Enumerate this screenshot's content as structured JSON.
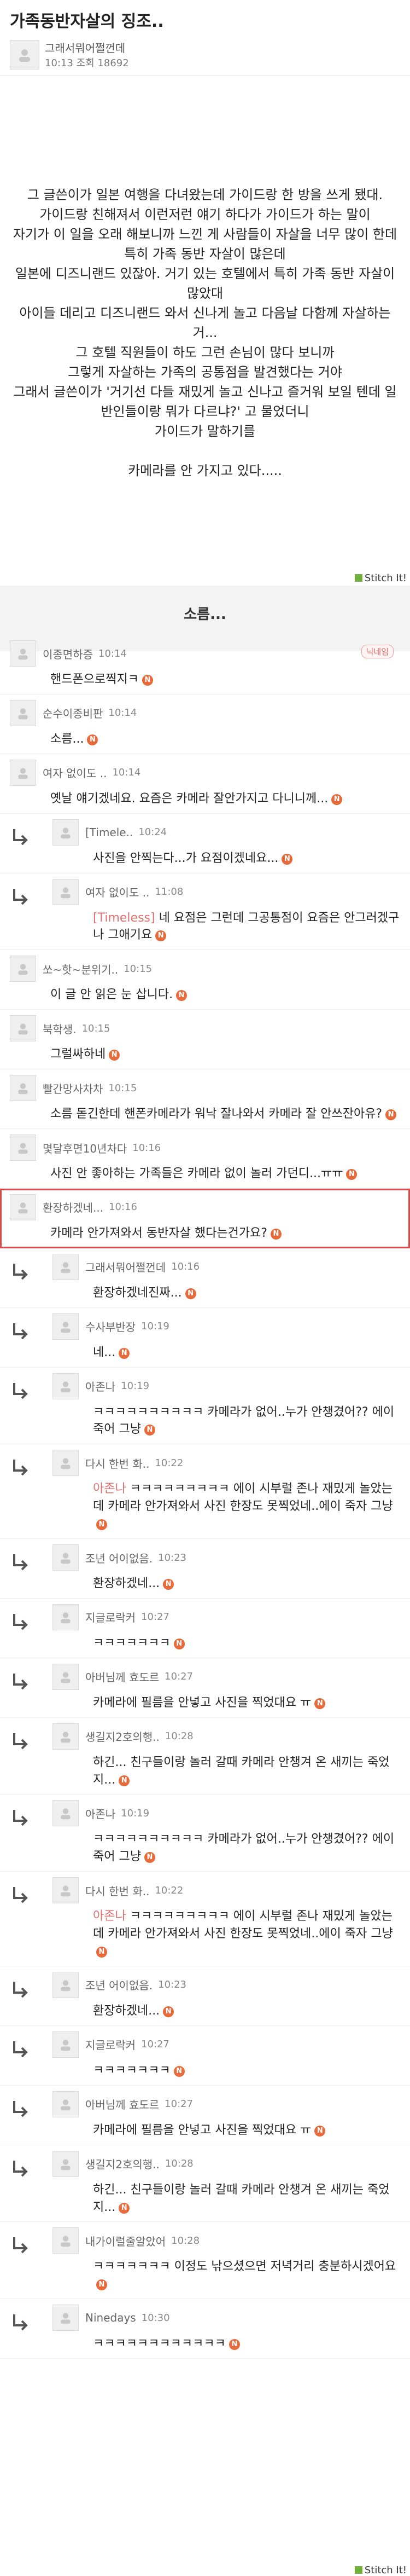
{
  "post": {
    "title": "가족동반자살의 징조..",
    "author": "그래서뭐어쩔껀데",
    "meta": "10:13  조회 18692",
    "lines": [
      "그 글쓴이가 일본 여행을 다녀왔는데 가이드랑 한 방을 쓰게 됐대.",
      "가이드랑 친해져서 이런저런 얘기 하다가 가이드가 하는 말이",
      "자기가 이 일을 오래 해보니까 느낀 게 사람들이 자살을 너무 많이 한데",
      "특히 가족 동반 자살이 많은데",
      "일본에 디즈니랜드 있잖아. 거기 있는 호텔에서 특히 가족 동반 자살이 많았대",
      "아이들 데리고 디즈니랜드 와서 신나게 놀고 다음날 다함께 자살하는 거...",
      "그 호텔 직원들이 하도 그런 손님이 많다 보니까",
      "그렇게 자살하는 가족의 공통점을 발견했다는 거야",
      "그래서 글쓴이가 '거기선 다들 재밌게 놀고 신나고 즐거워 보일 텐데 일반인들이랑 뭐가 다르냐?' 고 물었더니",
      "가이드가 말하기를",
      "",
      "카메라를 안 가지고 있다....."
    ],
    "separator": "소름...",
    "stitch": "Stitch It!"
  },
  "comments": [
    {
      "nick": "이종면하증",
      "time": "10:14",
      "text": "핸드폰으로찍지ㅋ",
      "badge": "닉네임"
    },
    {
      "nick": "순수이종비판",
      "time": "10:14",
      "text": "소름..."
    },
    {
      "nick": "여자 없이도 ..",
      "time": "10:14",
      "text": "옛날 얘기겠네요.  요즘은 카메라 잘안가지고 다니니께..."
    },
    {
      "nick": "[Timele..",
      "time": "10:24",
      "text": "사진을 안찍는다...가 요점이겠네요...",
      "reply": true
    },
    {
      "nick": "여자 없이도 ..",
      "time": "11:08",
      "text": "[Timeless] 네 요점은 그런데 그공통점이 요즘은 안그러겠구나 그애기요",
      "mention": "[Timeless]",
      "reply": true
    },
    {
      "nick": "쏘~핫~분위기..",
      "time": "10:15",
      "text": "이 글 안 읽은 눈 삽니다."
    },
    {
      "nick": "북학생.",
      "time": "10:15",
      "text": "그럴싸하네"
    },
    {
      "nick": "빨간망사차차",
      "time": "10:15",
      "text": "소름 돋긴한데 핸폰카메라가 워낙 잘나와서 카메라 잘 안쓰잔아유?"
    },
    {
      "nick": "몇달후면10년차다",
      "time": "10:16",
      "text": "사진 안 좋아하는 가족들은 카메라 없이 놀러 가던디...ㅠㅠ"
    },
    {
      "nick": "환장하겠네...",
      "time": "10:16",
      "text": "카메라 안가져와서 동반자살 했다는건가요?",
      "highlight": true
    },
    {
      "nick": "그래서뭐어쩔껀데",
      "time": "10:16",
      "text": "환장하겠네진짜...",
      "reply": true
    },
    {
      "nick": "수사부반장",
      "time": "10:19",
      "text": "네...",
      "reply": true
    },
    {
      "nick": "아존나",
      "time": "10:19",
      "text": "ㅋㅋㅋㅋㅋㅋㅋㅋㅋㅋ 카메라가 없어..누가 안챙겼어?? 에이 죽어 그냥",
      "reply": true
    },
    {
      "nick": "다시 한번 화..",
      "time": "10:22",
      "text": "아존나 ㅋㅋㅋㅋㅋㅋㅋㅋㅋ 에이 시부럴 존나 재밌게 놀았는데 카메라 안가져와서 사진 한장도 못찍었네..에이 죽자 그냥",
      "mention": "아존나",
      "reply": true
    },
    {
      "nick": "조년 어이없음.",
      "time": "10:23",
      "text": "환장하겠네...",
      "reply": true
    },
    {
      "nick": "지글로락커",
      "time": "10:27",
      "text": "ㅋㅋㅋㅋㅋㅋㅋ",
      "reply": true
    },
    {
      "nick": "아버님께 효도르",
      "time": "10:27",
      "text": "카메라에 필름을 안넣고 사진을 찍었대요 ㅠ",
      "reply": true
    },
    {
      "nick": "생길지2호의행..",
      "time": "10:28",
      "text": "하긴... 친구들이랑 놀러 갈때 카메라 안챙겨 온 새끼는 죽었지...",
      "reply": true
    },
    {
      "nick": "아존나",
      "time": "10:19",
      "text": "ㅋㅋㅋㅋㅋㅋㅋㅋㅋㅋ 카메라가 없어..누가 안챙겼어?? 에이 죽어 그냥",
      "reply": true
    },
    {
      "nick": "다시 한번 화..",
      "time": "10:22",
      "text": "아존나 ㅋㅋㅋㅋㅋㅋㅋㅋㅋ 에이 시부럴 존나 재밌게 놀았는데 카메라 안가져와서 사진 한장도 못찍었네..에이 죽자 그냥",
      "mention": "아존나",
      "reply": true
    },
    {
      "nick": "조년 어이없음.",
      "time": "10:23",
      "text": "환장하겠네...",
      "reply": true
    },
    {
      "nick": "지글로락커",
      "time": "10:27",
      "text": "ㅋㅋㅋㅋㅋㅋㅋ",
      "reply": true
    },
    {
      "nick": "아버님께 효도르",
      "time": "10:27",
      "text": "카메라에 필름을 안넣고 사진을 찍었대요 ㅠ",
      "reply": true
    },
    {
      "nick": "생길지2호의행..",
      "time": "10:28",
      "text": "하긴... 친구들이랑 놀러 갈때 카메라 안챙겨 온 새끼는 죽었지...",
      "reply": true
    },
    {
      "nick": "내가이럴줄알았어",
      "time": "10:28",
      "text": "ㅋㅋㅋㅋㅋㅋㅋ 이정도 낚으셨으면 저녁거리 충분하시겠어요",
      "reply": true
    },
    {
      "nick": "Ninedays",
      "time": "10:30",
      "text": "ㅋㅋㅋㅋㅋㅋㅋㅋㅋㅋㅋㅋ",
      "reply": true
    }
  ]
}
